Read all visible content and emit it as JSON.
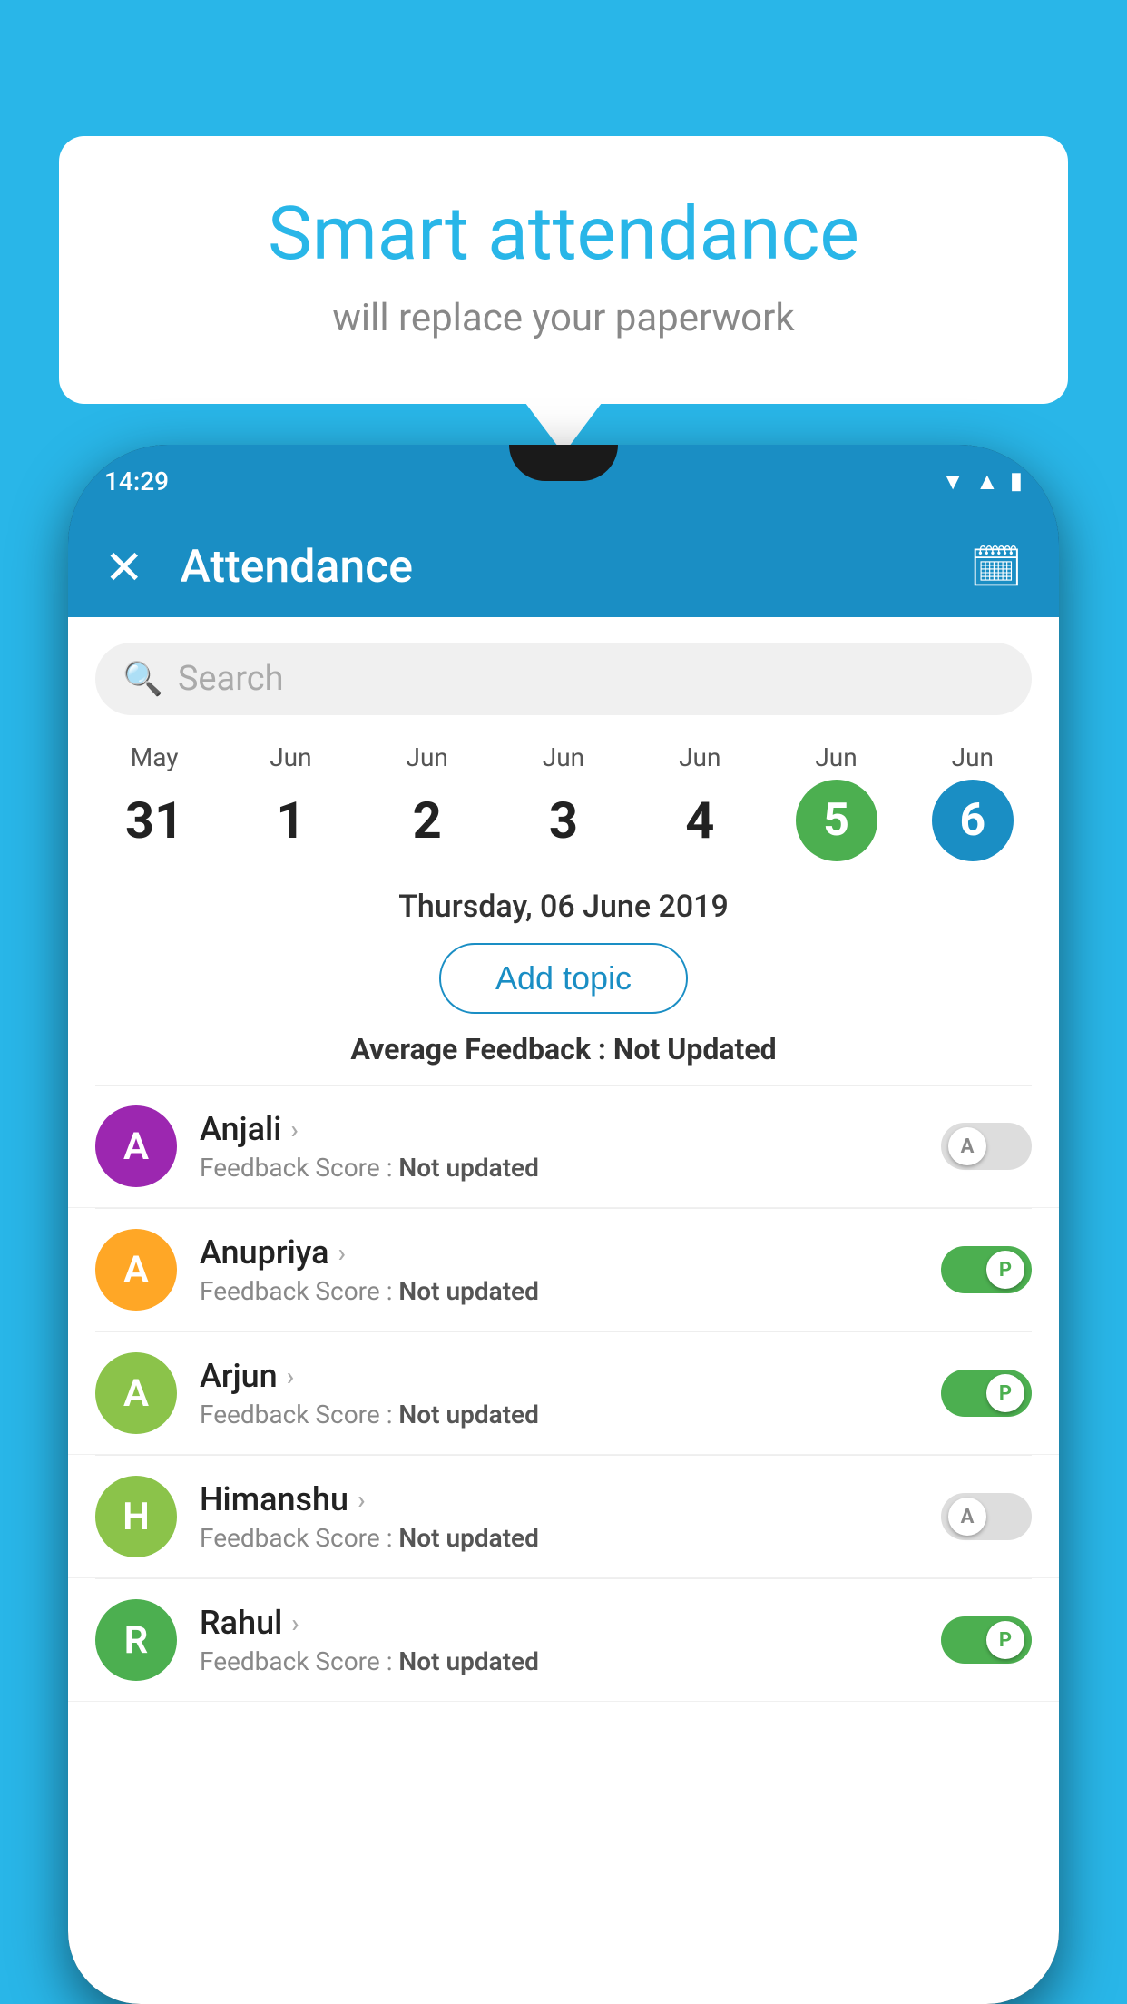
{
  "background_color": "#29b6e8",
  "bubble": {
    "title": "Smart attendance",
    "subtitle": "will replace your paperwork"
  },
  "status_bar": {
    "time": "14:29"
  },
  "app_bar": {
    "title": "Attendance",
    "close_label": "✕",
    "calendar_icon": "📅"
  },
  "search": {
    "placeholder": "Search"
  },
  "date_strip": {
    "columns": [
      {
        "month": "May",
        "day": "31",
        "selected": false
      },
      {
        "month": "Jun",
        "day": "1",
        "selected": false
      },
      {
        "month": "Jun",
        "day": "2",
        "selected": false
      },
      {
        "month": "Jun",
        "day": "3",
        "selected": false
      },
      {
        "month": "Jun",
        "day": "4",
        "selected": false
      },
      {
        "month": "Jun",
        "day": "5",
        "selected": "green"
      },
      {
        "month": "Jun",
        "day": "6",
        "selected": "blue"
      }
    ]
  },
  "selected_date_label": "Thursday, 06 June 2019",
  "add_topic_label": "Add topic",
  "avg_feedback_label": "Average Feedback : ",
  "avg_feedback_value": "Not Updated",
  "students": [
    {
      "name": "Anjali",
      "avatar_letter": "A",
      "avatar_color": "#9c27b0",
      "feedback_label": "Feedback Score : ",
      "feedback_value": "Not updated",
      "toggle": "off",
      "toggle_letter": "A"
    },
    {
      "name": "Anupriya",
      "avatar_letter": "A",
      "avatar_color": "#ffa726",
      "feedback_label": "Feedback Score : ",
      "feedback_value": "Not updated",
      "toggle": "on",
      "toggle_letter": "P"
    },
    {
      "name": "Arjun",
      "avatar_letter": "A",
      "avatar_color": "#8bc34a",
      "feedback_label": "Feedback Score : ",
      "feedback_value": "Not updated",
      "toggle": "on",
      "toggle_letter": "P"
    },
    {
      "name": "Himanshu",
      "avatar_letter": "H",
      "avatar_color": "#8bc34a",
      "feedback_label": "Feedback Score : ",
      "feedback_value": "Not updated",
      "toggle": "off",
      "toggle_letter": "A"
    },
    {
      "name": "Rahul",
      "avatar_letter": "R",
      "avatar_color": "#4caf50",
      "feedback_label": "Feedback Score : ",
      "feedback_value": "Not updated",
      "toggle": "on",
      "toggle_letter": "P"
    }
  ]
}
